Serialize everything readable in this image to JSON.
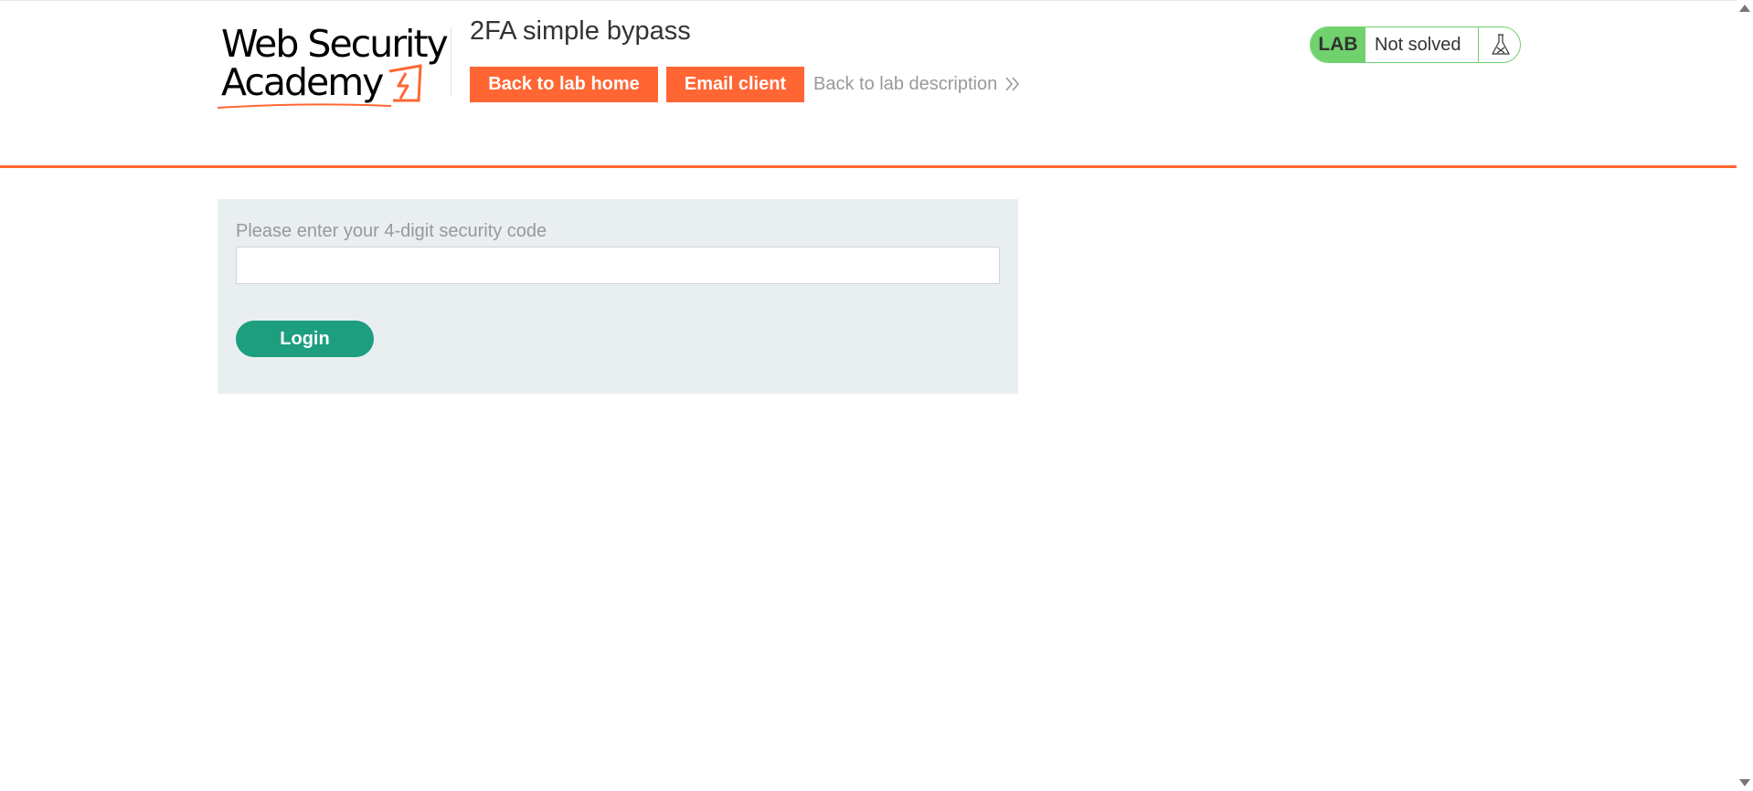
{
  "logo": {
    "line1": "Web Security",
    "line2": "Academy"
  },
  "header": {
    "title": "2FA simple bypass",
    "buttons": {
      "back_home": "Back to lab home",
      "email_client": "Email client"
    },
    "description_link": "Back to lab description",
    "accent_color": "#ff6633"
  },
  "lab_status": {
    "badge": "LAB",
    "state": "Not solved",
    "icon": "flask-icon",
    "color": "#70d16d"
  },
  "form": {
    "label": "Please enter your 4-digit security code",
    "value": "",
    "placeholder": "",
    "submit": "Login",
    "submit_color": "#1c9e7f"
  }
}
